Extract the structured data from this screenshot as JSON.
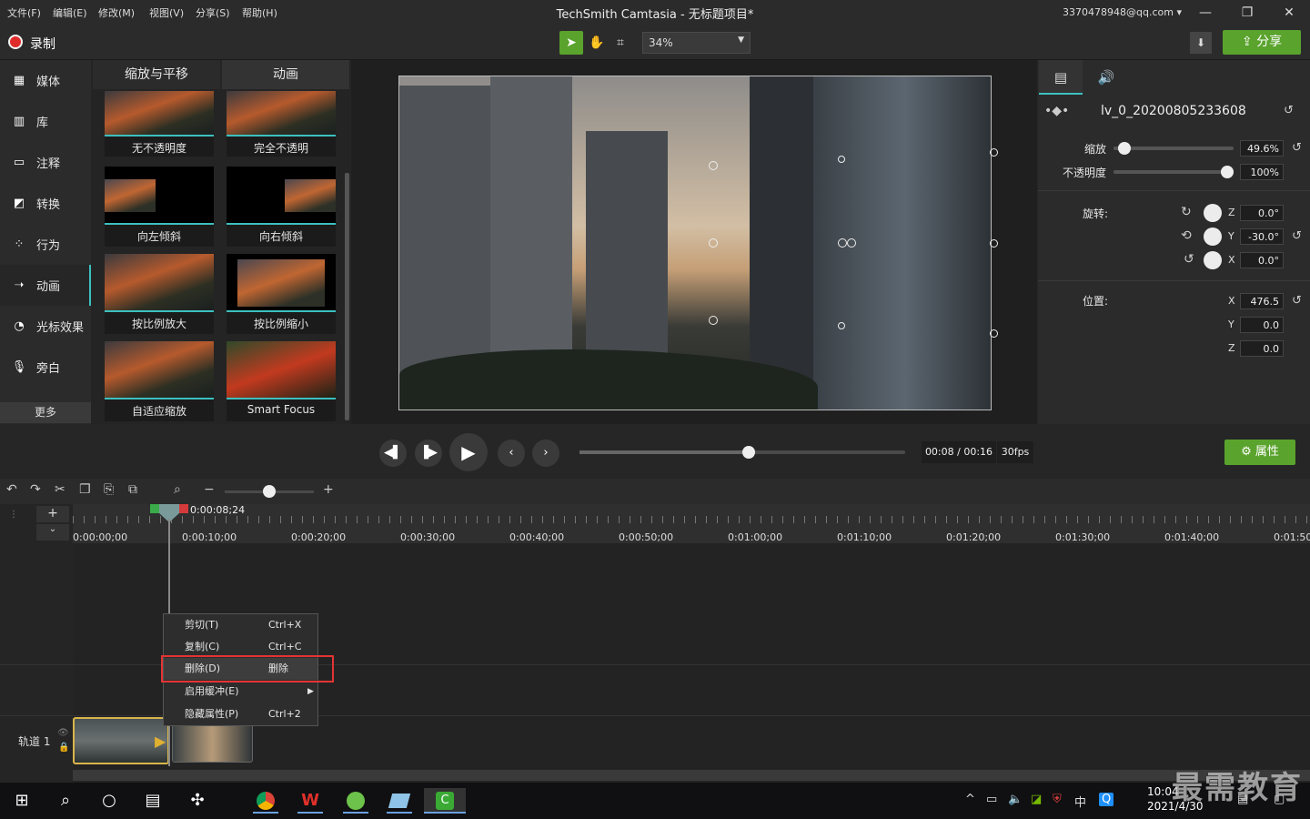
{
  "menu": [
    "文件(F)",
    "编辑(E)",
    "修改(M)",
    "视图(V)",
    "分享(S)",
    "帮助(H)"
  ],
  "app_title": "TechSmith Camtasia - 无标题项目*",
  "account": "3370478948@qq.com",
  "window_controls": {
    "minimize": "—",
    "maximize": "❐",
    "close": "✕"
  },
  "toolbar": {
    "record_label": "录制",
    "zoom": "34%",
    "share_label": "分享"
  },
  "sidebar": {
    "items": [
      {
        "label": "媒体",
        "icon": "media-icon"
      },
      {
        "label": "库",
        "icon": "library-icon"
      },
      {
        "label": "注释",
        "icon": "annotation-icon"
      },
      {
        "label": "转换",
        "icon": "transition-icon"
      },
      {
        "label": "行为",
        "icon": "behavior-icon"
      },
      {
        "label": "动画",
        "icon": "animation-icon"
      },
      {
        "label": "光标效果",
        "icon": "cursor-effect-icon"
      },
      {
        "label": "旁白",
        "icon": "microphone-icon"
      }
    ],
    "more": "更多"
  },
  "panel": {
    "tabs": [
      "缩放与平移",
      "动画"
    ],
    "thumbs": [
      "无不透明度",
      "完全不透明",
      "向左倾斜",
      "向右倾斜",
      "按比例放大",
      "按比例缩小",
      "自适应缩放",
      "Smart Focus"
    ]
  },
  "properties": {
    "clip_name": "lv_0_20200805233608",
    "scale_label": "缩放",
    "scale_value": "49.6%",
    "scale_level": 0.04,
    "opacity_label": "不透明度",
    "opacity_value": "100%",
    "opacity_level": 1.0,
    "rotation_label": "旋转:",
    "rot_z": "0.0°",
    "rot_y": "-30.0°",
    "rot_x": "0.0°",
    "position_label": "位置:",
    "pos_x": "476.5",
    "pos_y": "0.0",
    "pos_z": "0.0",
    "axis": {
      "x": "X",
      "y": "Y",
      "z": "Z"
    }
  },
  "playback": {
    "timecode": "00:08 / 00:16",
    "fps": "30fps",
    "progress": 0.5,
    "properties_label": "属性"
  },
  "timeline": {
    "playhead_time": "0:00:08;24",
    "ruler": [
      "0:00:00;00",
      "0:00:10;00",
      "0:00:20;00",
      "0:00:30;00",
      "0:00:40;00",
      "0:00:50;00",
      "0:01:00;00",
      "0:01:10;00",
      "0:01:20;00",
      "0:01:30;00",
      "0:01:40;00",
      "0:01:50;"
    ],
    "track_label": "轨道 1"
  },
  "context_menu": [
    {
      "label": "剪切(T)",
      "shortcut": "Ctrl+X"
    },
    {
      "label": "复制(C)",
      "shortcut": "Ctrl+C"
    },
    {
      "label": "删除(D)",
      "shortcut": "删除"
    },
    {
      "label": "启用缓冲(E)",
      "shortcut": ""
    },
    {
      "label": "隐藏属性(P)",
      "shortcut": "Ctrl+2"
    }
  ],
  "taskbar": {
    "ime": "中",
    "time": "10:04",
    "date": "2021/4/30"
  },
  "watermark": "最需教育",
  "colors": {
    "accent_green": "#5aa32d",
    "teal": "#3cc0c0",
    "record_red": "#e02b2b",
    "highlight_red": "#e53333"
  }
}
